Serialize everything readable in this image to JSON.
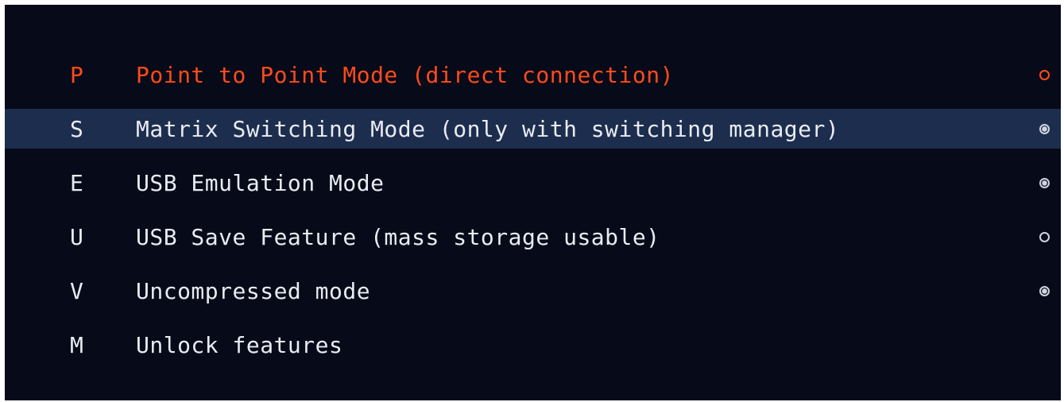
{
  "menu": {
    "items": [
      {
        "key": "P",
        "label": "Point to Point Mode (direct connection)",
        "indicator": "off-icon",
        "state": "active"
      },
      {
        "key": "S",
        "label": "Matrix Switching Mode (only with switching manager)",
        "indicator": "selected-icon",
        "state": "highlighted"
      },
      {
        "key": "E",
        "label": "USB Emulation Mode",
        "indicator": "selected-icon",
        "state": "normal"
      },
      {
        "key": "U",
        "label": "USB Save Feature (mass storage usable)",
        "indicator": "off-icon",
        "state": "normal"
      },
      {
        "key": "V",
        "label": "Uncompressed mode",
        "indicator": "selected-icon",
        "state": "normal"
      },
      {
        "key": "M",
        "label": "Unlock features",
        "indicator": "none",
        "state": "normal"
      }
    ]
  },
  "colors": {
    "background": "#070a18",
    "highlight": "#1d2d4e",
    "active_text": "#ff4a1c",
    "text": "#e8ecf2"
  }
}
